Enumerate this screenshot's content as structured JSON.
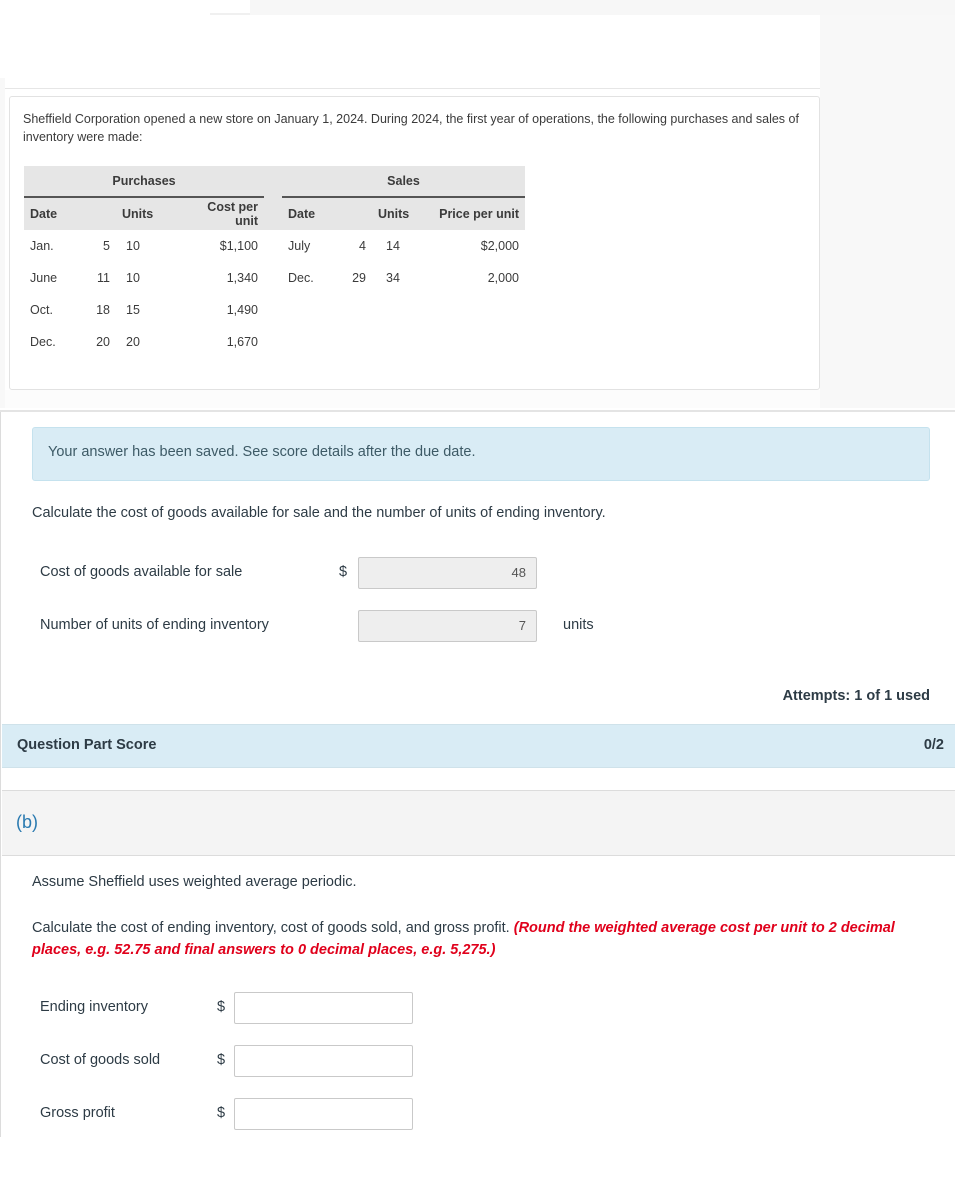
{
  "problem": {
    "intro": "Sheffield Corporation opened a new store on January 1, 2024. During 2024, the first year of operations, the following purchases and sales of inventory were made:",
    "table": {
      "purchases_header": "Purchases",
      "sales_header": "Sales",
      "columns": {
        "p_date": "Date",
        "p_units": "Units",
        "p_cost": "Cost per unit",
        "s_date": "Date",
        "s_units": "Units",
        "s_price": "Price per unit"
      },
      "purchases": [
        {
          "month": "Jan.",
          "day": "5",
          "units": "10",
          "cost": "$1,100"
        },
        {
          "month": "June",
          "day": "11",
          "units": "10",
          "cost": "1,340"
        },
        {
          "month": "Oct.",
          "day": "18",
          "units": "15",
          "cost": "1,490"
        },
        {
          "month": "Dec.",
          "day": "20",
          "units": "20",
          "cost": "1,670"
        }
      ],
      "sales": [
        {
          "month": "July",
          "day": "4",
          "units": "14",
          "price": "$2,000"
        },
        {
          "month": "Dec.",
          "day": "29",
          "units": "34",
          "price": "2,000"
        }
      ]
    }
  },
  "part_a": {
    "saved_message": "Your answer has been saved. See score details after the due date.",
    "instruction": "Calculate the cost of goods available for sale and the number of units of ending inventory.",
    "fields": [
      {
        "label": "Cost of goods available for sale",
        "prefix": "$",
        "value": "48",
        "suffix": ""
      },
      {
        "label": "Number of units of ending inventory",
        "prefix": "",
        "value": "7",
        "suffix": "units"
      }
    ],
    "attempts": "Attempts: 1 of 1 used",
    "score_label": "Question Part Score",
    "score_value": "0/2"
  },
  "part_b": {
    "label": "(b)",
    "assumption": "Assume Sheffield uses weighted average periodic.",
    "instruction": "Calculate the cost of ending inventory, cost of goods sold, and gross profit.",
    "note": "(Round the weighted average cost per unit to 2 decimal places, e.g. 52.75 and final answers to 0 decimal places, e.g. 5,275.)",
    "fields": [
      {
        "label": "Ending inventory",
        "prefix": "$",
        "value": ""
      },
      {
        "label": "Cost of goods sold",
        "prefix": "$",
        "value": ""
      },
      {
        "label": "Gross profit",
        "prefix": "$",
        "value": ""
      }
    ]
  },
  "colors": {
    "info_banner": "#d9ecf5",
    "part_label": "#2a7ab0",
    "note_red": "#e0001b"
  }
}
